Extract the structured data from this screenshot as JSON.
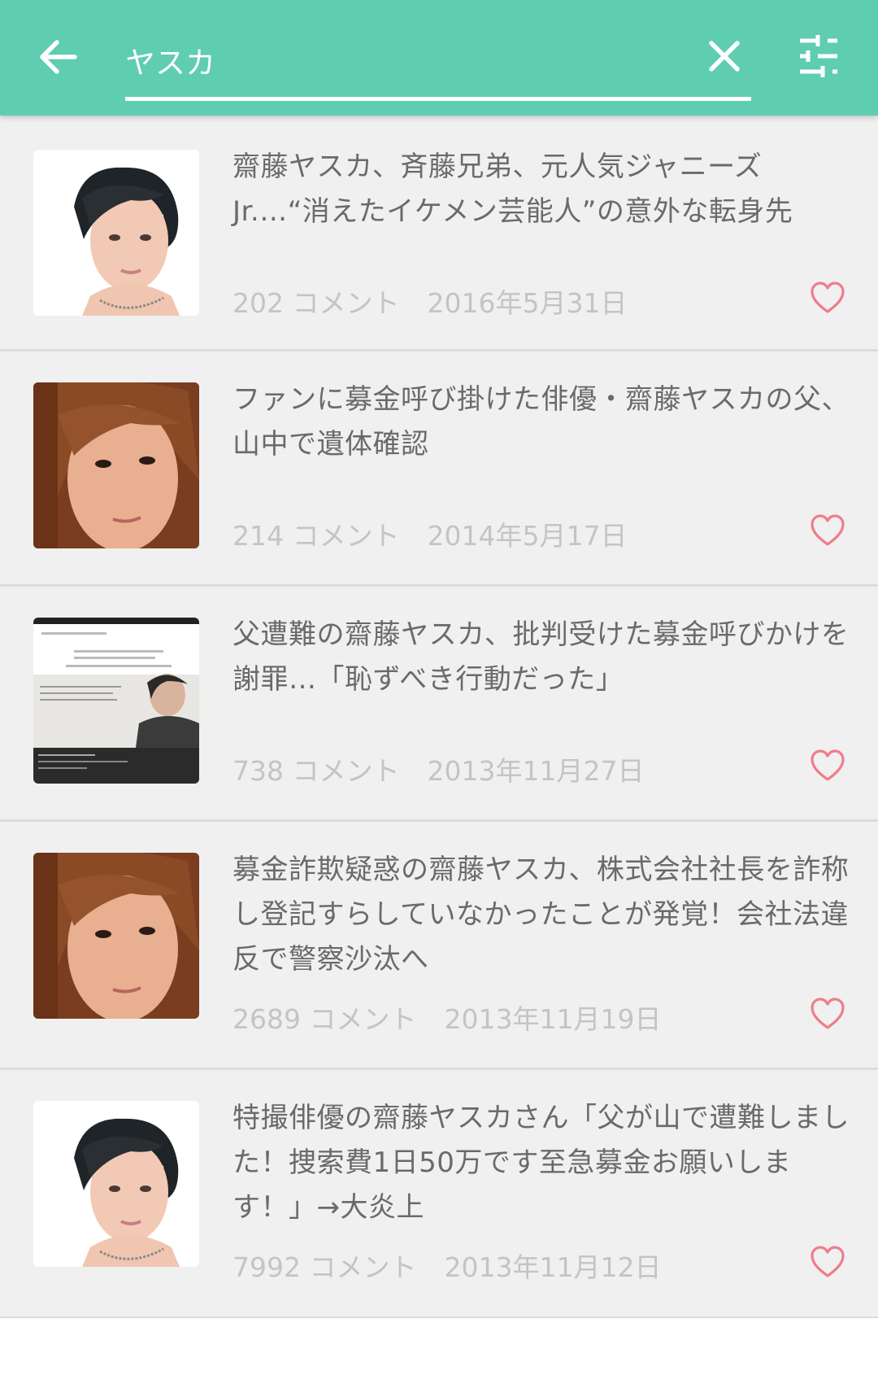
{
  "toolbar": {
    "search_value": "ヤスカ",
    "back_icon": "arrow-left-icon",
    "clear_icon": "close-icon",
    "filter_icon": "sliders-icon",
    "color": "#5fcdb0"
  },
  "results": [
    {
      "title": "齋藤ヤスカ、斉藤兄弟、元人気ジャニーズJr.…“消えたイケメン芸能人”の意外な転身先",
      "comments": "202 コメント",
      "date": "2016年5月31日"
    },
    {
      "title": "ファンに募金呼び掛けた俳優・齋藤ヤスカの父、山中で遺体確認",
      "comments": "214 コメント",
      "date": "2014年5月17日"
    },
    {
      "title": "父遭難の齋藤ヤスカ、批判受けた募金呼びかけを謝罪…「恥ずべき行動だった」",
      "comments": "738 コメント",
      "date": "2013年11月27日"
    },
    {
      "title": "募金詐欺疑惑の齋藤ヤスカ、株式会社社長を詐称し登記すらしていなかったことが発覚！会社法違反で警察沙汰へ",
      "comments": "2689 コメント",
      "date": "2013年11月19日"
    },
    {
      "title": "特撮俳優の齋藤ヤスカさん「父が山で遭難しました！捜索費1日50万です至急募金お願いします！」→大炎上",
      "comments": "7992 コメント",
      "date": "2013年11月12日"
    }
  ],
  "colors": {
    "heart": "#ef7d8a",
    "meta_text": "#c4c4c4",
    "title_text": "#6a6a6a",
    "row_bg": "#f0f0f0"
  }
}
